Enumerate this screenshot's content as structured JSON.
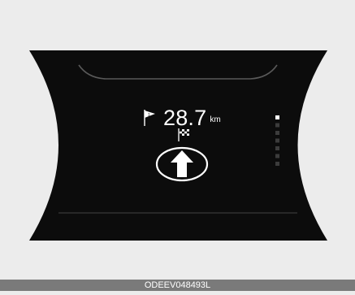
{
  "navigation": {
    "distance_value": "28.7",
    "distance_unit": "km",
    "waypoint_number": "1",
    "waypoint_icon": "waypoint-flag-icon",
    "destination_icon": "checkered-flag-icon",
    "maneuver_icon": "straight-arrow-icon"
  },
  "indicator": {
    "total_segments": 7,
    "active_segments": 1
  },
  "caption": {
    "code": "ODEEV048493L"
  },
  "colors": {
    "background": "#ececec",
    "display": "#0c0c0c",
    "text": "#ffffff",
    "caption_bar": "#7a7a7a"
  }
}
